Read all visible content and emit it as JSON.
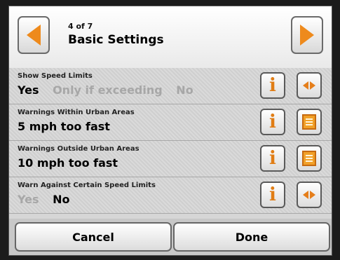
{
  "header": {
    "page_indicator": "4 of 7",
    "title": "Basic Settings",
    "prev_icon": "arrow-left-icon",
    "next_icon": "arrow-right-icon"
  },
  "rows": [
    {
      "label": "Show Speed Limits",
      "options": [
        {
          "text": "Yes",
          "selected": true
        },
        {
          "text": "Only if exceeding",
          "selected": false
        },
        {
          "text": "No",
          "selected": false
        }
      ],
      "info_icon": "info-icon",
      "action_icon": "left-right-arrows-icon"
    },
    {
      "label": "Warnings Within Urban Areas",
      "value": "5 mph too fast",
      "info_icon": "info-icon",
      "action_icon": "list-icon"
    },
    {
      "label": "Warnings Outside Urban Areas",
      "value": "10 mph too fast",
      "info_icon": "info-icon",
      "action_icon": "list-icon"
    },
    {
      "label": "Warn Against Certain Speed Limits",
      "options": [
        {
          "text": "Yes",
          "selected": false
        },
        {
          "text": "No",
          "selected": true
        }
      ],
      "info_icon": "info-icon",
      "action_icon": "left-right-arrows-icon"
    }
  ],
  "footer": {
    "cancel_label": "Cancel",
    "done_label": "Done"
  },
  "colors": {
    "accent": "#ee8a1c",
    "inactive_text": "#a7a7a7"
  }
}
